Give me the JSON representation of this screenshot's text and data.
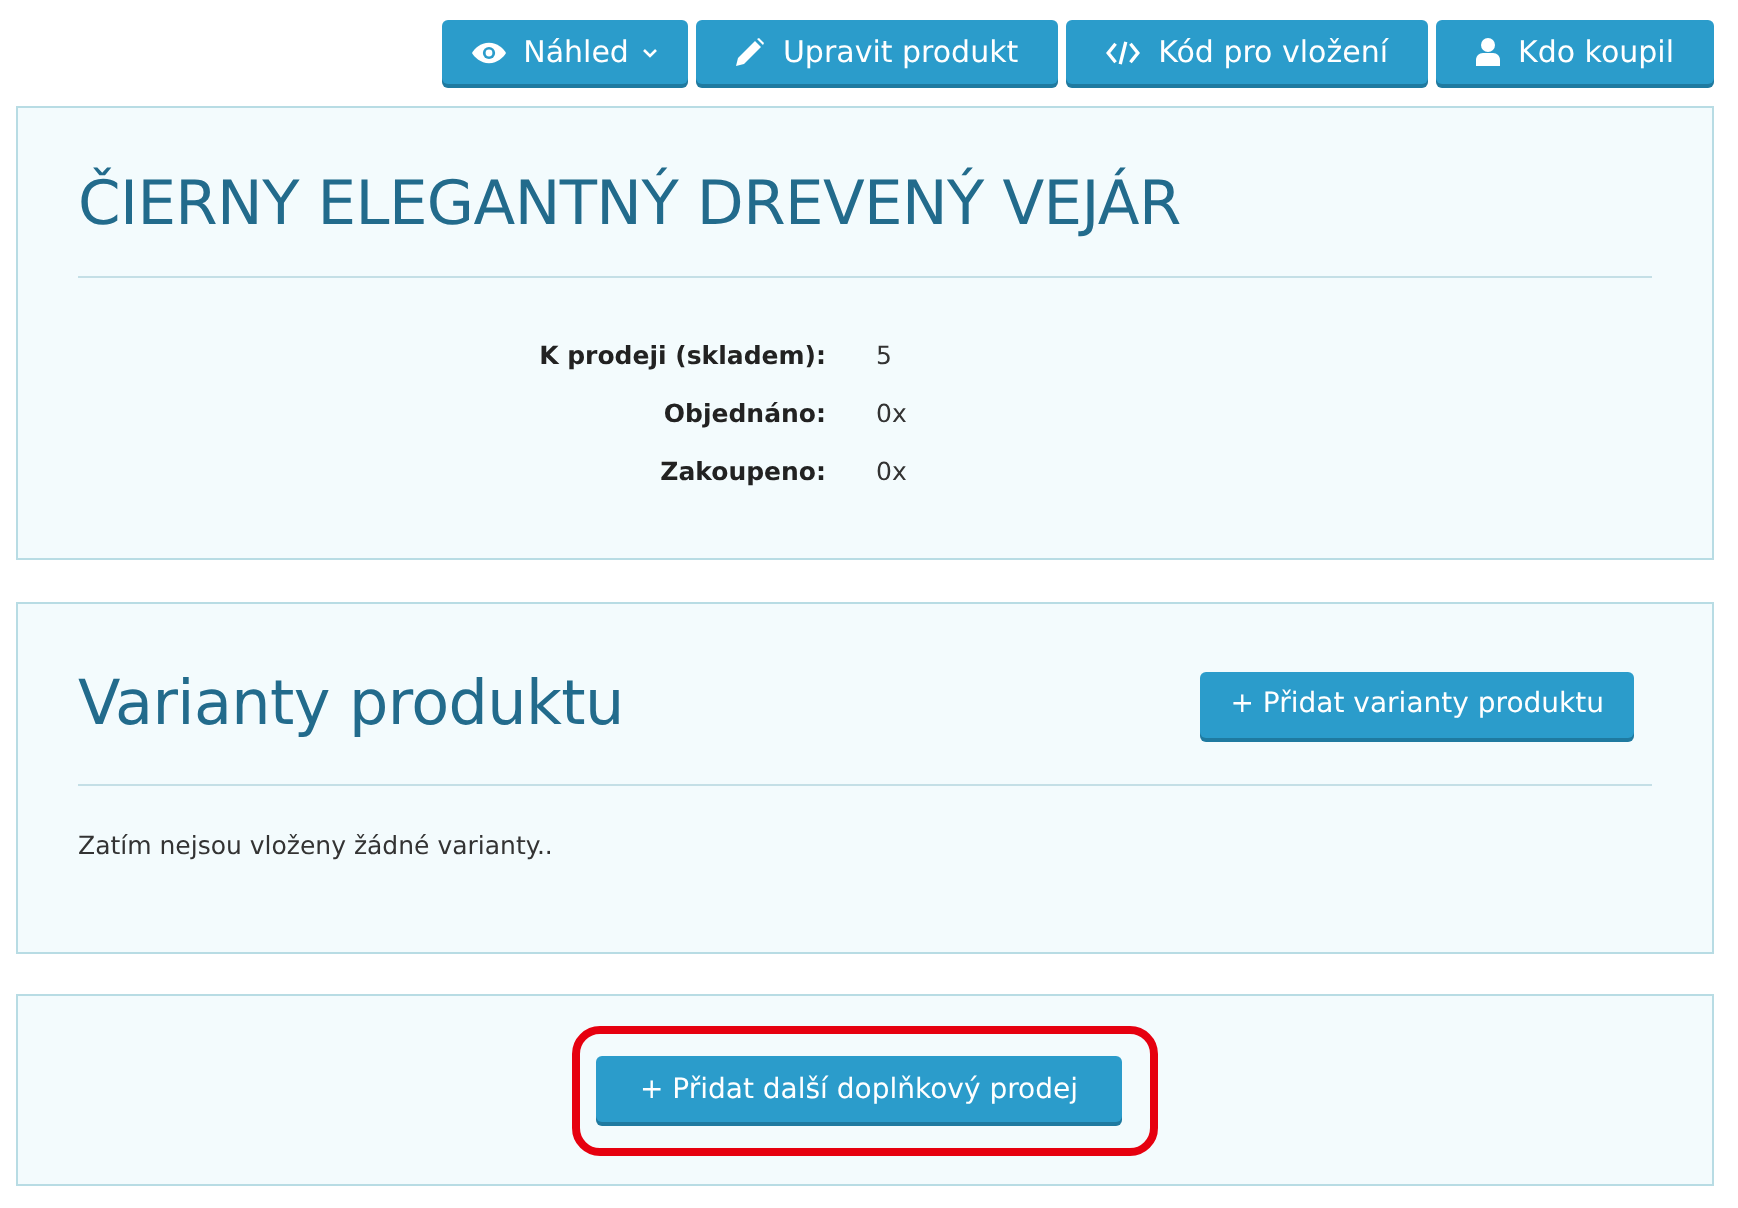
{
  "toolbar": {
    "buttons": [
      {
        "label": "Náhled",
        "kind": "preview",
        "dropdown": true
      },
      {
        "label": "Upravit produkt",
        "kind": "edit",
        "dropdown": false
      },
      {
        "label": "Kód pro vložení",
        "kind": "embed",
        "dropdown": false
      },
      {
        "label": "Kdo koupil",
        "kind": "buyers",
        "dropdown": false
      }
    ]
  },
  "product": {
    "title": "ČIERNY ELEGANTNÝ DREVENÝ VEJÁR",
    "stats": [
      {
        "label": "K prodeji (skladem):",
        "value": "5"
      },
      {
        "label": "Objednáno:",
        "value": "0x"
      },
      {
        "label": "Zakoupeno:",
        "value": "0x"
      }
    ]
  },
  "variants": {
    "heading": "Varianty produktu",
    "add_button": "+ Přidat varianty produktu",
    "empty_message": "Zatím nejsou vloženy žádné varianty.."
  },
  "upsell": {
    "add_button": {
      "label": "+ Přidat další doplňkový prodej",
      "highlighted": true
    }
  }
}
